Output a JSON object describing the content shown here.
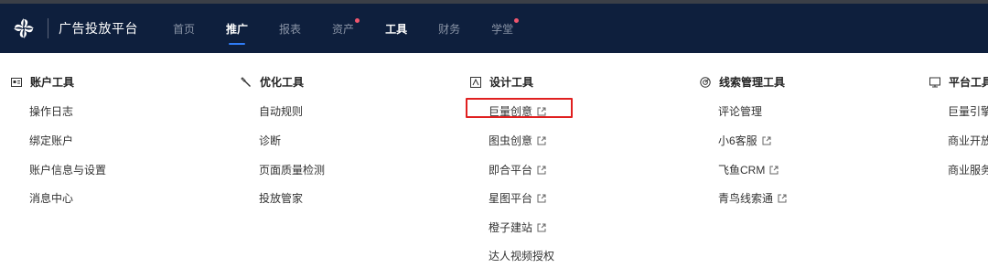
{
  "app": {
    "brand": "广告投放平台"
  },
  "nav": {
    "items": [
      {
        "label": "首页"
      },
      {
        "label": "推广"
      },
      {
        "label": "报表"
      },
      {
        "label": "资产"
      },
      {
        "label": "工具"
      },
      {
        "label": "财务"
      },
      {
        "label": "学堂"
      }
    ]
  },
  "menu": {
    "columns": [
      {
        "title": "账户工具",
        "icon": "id-card-icon",
        "items": [
          {
            "label": "操作日志"
          },
          {
            "label": "绑定账户"
          },
          {
            "label": "账户信息与设置"
          },
          {
            "label": "消息中心"
          }
        ]
      },
      {
        "title": "优化工具",
        "icon": "wrench-icon",
        "items": [
          {
            "label": "自动规则"
          },
          {
            "label": "诊断"
          },
          {
            "label": "页面质量检测"
          },
          {
            "label": "投放管家"
          }
        ]
      },
      {
        "title": "设计工具",
        "icon": "design-icon",
        "items": [
          {
            "label": "巨量创意",
            "external": true
          },
          {
            "label": "图虫创意",
            "external": true
          },
          {
            "label": "即合平台",
            "external": true
          },
          {
            "label": "星图平台",
            "external": true
          },
          {
            "label": "橙子建站",
            "external": true
          },
          {
            "label": "达人视频授权"
          }
        ]
      },
      {
        "title": "线索管理工具",
        "icon": "target-icon",
        "items": [
          {
            "label": "评论管理"
          },
          {
            "label": "小6客服",
            "external": true
          },
          {
            "label": "飞鱼CRM",
            "external": true
          },
          {
            "label": "青鸟线索通",
            "external": true
          }
        ]
      },
      {
        "title": "平台工具",
        "icon": "monitor-icon",
        "items": [
          {
            "label": "巨量引擎"
          },
          {
            "label": "商业开放"
          },
          {
            "label": "商业服务"
          }
        ]
      }
    ]
  }
}
